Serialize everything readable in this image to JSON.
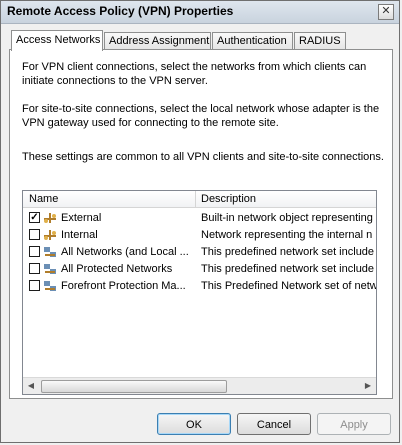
{
  "window": {
    "title": "Remote Access Policy (VPN) Properties",
    "close_label": "✕"
  },
  "tabs": [
    {
      "label": "Access Networks"
    },
    {
      "label": "Address Assignment"
    },
    {
      "label": "Authentication"
    },
    {
      "label": "RADIUS"
    }
  ],
  "panel": {
    "para1": "For VPN client connections, select the networks from which clients can initiate connections to the VPN server.",
    "para2": "For site-to-site connections, select the local network whose adapter is the VPN gateway used for connecting to the remote site.",
    "para3": "These settings are common to all VPN clients and site-to-site connections."
  },
  "listview": {
    "columns": {
      "name": "Name",
      "description": "Description"
    },
    "rows": [
      {
        "checked": true,
        "check": "✓",
        "name": "External",
        "description": "Built-in network object representing"
      },
      {
        "checked": false,
        "check": "",
        "name": "Internal",
        "description": "Network representing the internal n"
      },
      {
        "checked": false,
        "check": "",
        "name": "All Networks (and Local ...",
        "description": "This predefined network set include"
      },
      {
        "checked": false,
        "check": "",
        "name": "All Protected Networks",
        "description": "This predefined network set include"
      },
      {
        "checked": false,
        "check": "",
        "name": "Forefront Protection Ma...",
        "description": "This Predefined Network set of netw"
      }
    ],
    "scroll_left": "◀",
    "scroll_right": "▶"
  },
  "buttons": {
    "ok": "OK",
    "cancel": "Cancel",
    "apply": "Apply"
  }
}
